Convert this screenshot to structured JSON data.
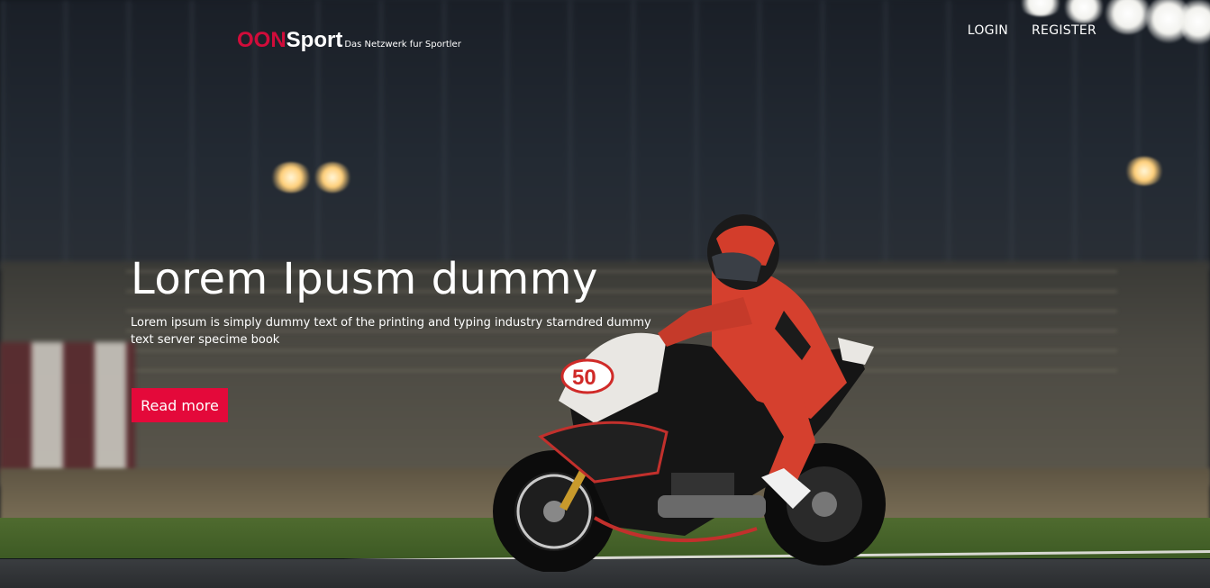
{
  "brand": {
    "accent": "OON",
    "main": "Sport",
    "tagline": "Das Netzwerk fur Sportler",
    "accent_color": "#d10c3a"
  },
  "nav": {
    "login": "LOGIN",
    "register": "REGISTER"
  },
  "hero": {
    "title": "Lorem Ipusm dummy",
    "text": "Lorem ipsum is simply dummy text of the printing and typing industry starndred dummy text server specime book",
    "button_label": "Read more",
    "button_color": "#e4093a",
    "background_image": "motorcycle-racer-night-track"
  }
}
